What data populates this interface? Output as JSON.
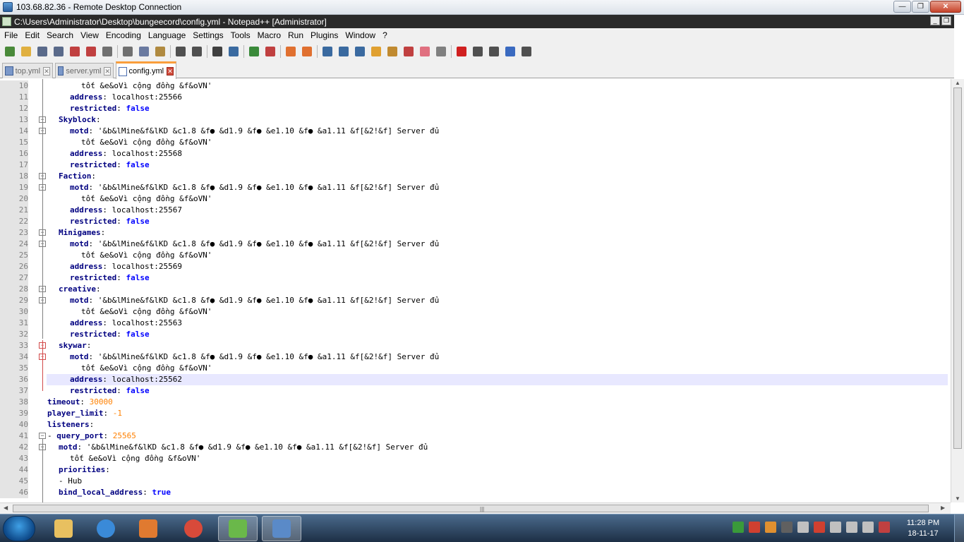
{
  "rdp": {
    "title": "103.68.82.36 - Remote Desktop Connection"
  },
  "window": {
    "title": "C:\\Users\\Administrator\\Desktop\\bungeecord\\config.yml - Notepad++ [Administrator]"
  },
  "menu": [
    "File",
    "Edit",
    "Search",
    "View",
    "Encoding",
    "Language",
    "Settings",
    "Tools",
    "Macro",
    "Run",
    "Plugins",
    "Window",
    "?"
  ],
  "toolbar": {
    "buttons": [
      {
        "icon": "new-file-icon",
        "color": "#4a8a3a"
      },
      {
        "icon": "open-file-icon",
        "color": "#e0b040"
      },
      {
        "icon": "save-icon",
        "color": "#5a6a8a"
      },
      {
        "icon": "save-all-icon",
        "color": "#5a6a8a"
      },
      {
        "icon": "close-icon",
        "color": "#c04040"
      },
      {
        "icon": "close-all-icon",
        "color": "#c04040"
      },
      {
        "icon": "print-icon",
        "color": "#707070"
      },
      {
        "sep": true
      },
      {
        "icon": "cut-icon",
        "color": "#707070"
      },
      {
        "icon": "copy-icon",
        "color": "#6a7aa0"
      },
      {
        "icon": "paste-icon",
        "color": "#b08a40"
      },
      {
        "sep": true
      },
      {
        "icon": "undo-icon",
        "color": "#505050"
      },
      {
        "icon": "redo-icon",
        "color": "#505050"
      },
      {
        "sep": true
      },
      {
        "icon": "find-icon",
        "color": "#404040"
      },
      {
        "icon": "replace-icon",
        "color": "#3a6aa0"
      },
      {
        "sep": true
      },
      {
        "icon": "zoom-in-icon",
        "color": "#3a8a3a"
      },
      {
        "icon": "zoom-out-icon",
        "color": "#c04040"
      },
      {
        "sep": true
      },
      {
        "icon": "sync-vertical-icon",
        "color": "#e07030"
      },
      {
        "icon": "sync-horizontal-icon",
        "color": "#e07030"
      },
      {
        "sep": true
      },
      {
        "icon": "word-wrap-icon",
        "color": "#3a6aa0"
      },
      {
        "icon": "show-all-characters-icon",
        "color": "#3a6aa0"
      },
      {
        "icon": "indent-guide-icon",
        "color": "#3a6aa0"
      },
      {
        "icon": "udl-icon",
        "color": "#e0a030"
      },
      {
        "icon": "doc-map-icon",
        "color": "#c08a30"
      },
      {
        "icon": "function-list-icon",
        "color": "#c04040"
      },
      {
        "icon": "folder-as-workspace-icon",
        "color": "#e07080"
      },
      {
        "icon": "monitoring-icon",
        "color": "#808080"
      },
      {
        "sep": true
      },
      {
        "icon": "record-macro-icon",
        "color": "#d02020"
      },
      {
        "icon": "stop-recording-icon",
        "color": "#505050"
      },
      {
        "icon": "playback-icon",
        "color": "#505050"
      },
      {
        "icon": "run-macro-multiple-icon",
        "color": "#3a6ac0"
      },
      {
        "icon": "save-macro-icon",
        "color": "#505050"
      }
    ]
  },
  "tabs": [
    {
      "label": "top.yml",
      "active": false
    },
    {
      "label": "server.yml",
      "active": false
    },
    {
      "label": "config.yml",
      "active": true
    }
  ],
  "editor": {
    "lines": [
      {
        "n": "10",
        "indent": 3,
        "parts": [
          {
            "t": "tốt &e&oVì cộng đồng &f&oVN'",
            "c": "v"
          }
        ]
      },
      {
        "n": "11",
        "indent": 2,
        "parts": [
          {
            "t": "address",
            "c": "k"
          },
          {
            "t": ": localhost:25566",
            "c": "v"
          }
        ]
      },
      {
        "n": "12",
        "indent": 2,
        "parts": [
          {
            "t": "restricted",
            "c": "k"
          },
          {
            "t": ": ",
            "c": "v"
          },
          {
            "t": "false",
            "c": "b"
          }
        ]
      },
      {
        "n": "13",
        "indent": 1,
        "parts": [
          {
            "t": "Skyblock",
            "c": "k"
          },
          {
            "t": ":",
            "c": "v"
          }
        ]
      },
      {
        "n": "14",
        "indent": 2,
        "parts": [
          {
            "t": "motd",
            "c": "k"
          },
          {
            "t": ": '&b&lMine&f&lKD &c1.8 &f● &d1.9 &f● &e1.10 &f● &a1.11 &f[&2!&f] Server đủ",
            "c": "v"
          }
        ]
      },
      {
        "n": "15",
        "indent": 3,
        "parts": [
          {
            "t": "tốt &e&oVì cộng đồng &f&oVN'",
            "c": "v"
          }
        ]
      },
      {
        "n": "16",
        "indent": 2,
        "parts": [
          {
            "t": "address",
            "c": "k"
          },
          {
            "t": ": localhost:25568",
            "c": "v"
          }
        ]
      },
      {
        "n": "17",
        "indent": 2,
        "parts": [
          {
            "t": "restricted",
            "c": "k"
          },
          {
            "t": ": ",
            "c": "v"
          },
          {
            "t": "false",
            "c": "b"
          }
        ]
      },
      {
        "n": "18",
        "indent": 1,
        "parts": [
          {
            "t": "Faction",
            "c": "k"
          },
          {
            "t": ":",
            "c": "v"
          }
        ]
      },
      {
        "n": "19",
        "indent": 2,
        "parts": [
          {
            "t": "motd",
            "c": "k"
          },
          {
            "t": ": '&b&lMine&f&lKD &c1.8 &f● &d1.9 &f● &e1.10 &f● &a1.11 &f[&2!&f] Server đủ",
            "c": "v"
          }
        ]
      },
      {
        "n": "20",
        "indent": 3,
        "parts": [
          {
            "t": "tốt &e&oVì cộng đồng &f&oVN'",
            "c": "v"
          }
        ]
      },
      {
        "n": "21",
        "indent": 2,
        "parts": [
          {
            "t": "address",
            "c": "k"
          },
          {
            "t": ": localhost:25567",
            "c": "v"
          }
        ]
      },
      {
        "n": "22",
        "indent": 2,
        "parts": [
          {
            "t": "restricted",
            "c": "k"
          },
          {
            "t": ": ",
            "c": "v"
          },
          {
            "t": "false",
            "c": "b"
          }
        ]
      },
      {
        "n": "23",
        "indent": 1,
        "parts": [
          {
            "t": "Minigames",
            "c": "k"
          },
          {
            "t": ":",
            "c": "v"
          }
        ]
      },
      {
        "n": "24",
        "indent": 2,
        "parts": [
          {
            "t": "motd",
            "c": "k"
          },
          {
            "t": ": '&b&lMine&f&lKD &c1.8 &f● &d1.9 &f● &e1.10 &f● &a1.11 &f[&2!&f] Server đủ",
            "c": "v"
          }
        ]
      },
      {
        "n": "25",
        "indent": 3,
        "parts": [
          {
            "t": "tốt &e&oVì cộng đồng &f&oVN'",
            "c": "v"
          }
        ]
      },
      {
        "n": "26",
        "indent": 2,
        "parts": [
          {
            "t": "address",
            "c": "k"
          },
          {
            "t": ": localhost:25569",
            "c": "v"
          }
        ]
      },
      {
        "n": "27",
        "indent": 2,
        "parts": [
          {
            "t": "restricted",
            "c": "k"
          },
          {
            "t": ": ",
            "c": "v"
          },
          {
            "t": "false",
            "c": "b"
          }
        ]
      },
      {
        "n": "28",
        "indent": 1,
        "parts": [
          {
            "t": "creative",
            "c": "k"
          },
          {
            "t": ":",
            "c": "v"
          }
        ]
      },
      {
        "n": "29",
        "indent": 2,
        "parts": [
          {
            "t": "motd",
            "c": "k"
          },
          {
            "t": ": '&b&lMine&f&lKD &c1.8 &f● &d1.9 &f● &e1.10 &f● &a1.11 &f[&2!&f] Server đủ",
            "c": "v"
          }
        ]
      },
      {
        "n": "30",
        "indent": 3,
        "parts": [
          {
            "t": "tốt &e&oVì cộng đồng &f&oVN'",
            "c": "v"
          }
        ]
      },
      {
        "n": "31",
        "indent": 2,
        "parts": [
          {
            "t": "address",
            "c": "k"
          },
          {
            "t": ": localhost:25563",
            "c": "v"
          }
        ]
      },
      {
        "n": "32",
        "indent": 2,
        "parts": [
          {
            "t": "restricted",
            "c": "k"
          },
          {
            "t": ": ",
            "c": "v"
          },
          {
            "t": "false",
            "c": "b"
          }
        ]
      },
      {
        "n": "33",
        "indent": 1,
        "parts": [
          {
            "t": "skywar",
            "c": "k"
          },
          {
            "t": ":",
            "c": "v"
          }
        ]
      },
      {
        "n": "34",
        "indent": 2,
        "parts": [
          {
            "t": "motd",
            "c": "k"
          },
          {
            "t": ": '&b&lMine&f&lKD &c1.8 &f● &d1.9 &f● &e1.10 &f● &a1.11 &f[&2!&f] Server đủ",
            "c": "v"
          }
        ]
      },
      {
        "n": "35",
        "indent": 3,
        "parts": [
          {
            "t": "tốt &e&oVì cộng đồng &f&oVN'",
            "c": "v"
          }
        ]
      },
      {
        "n": "36",
        "indent": 2,
        "current": true,
        "parts": [
          {
            "t": "address",
            "c": "k"
          },
          {
            "t": ": localhost:25562",
            "c": "v"
          }
        ]
      },
      {
        "n": "37",
        "indent": 2,
        "parts": [
          {
            "t": "restricted",
            "c": "k"
          },
          {
            "t": ": ",
            "c": "v"
          },
          {
            "t": "false",
            "c": "b"
          }
        ]
      },
      {
        "n": "38",
        "indent": 0,
        "parts": [
          {
            "t": "timeout",
            "c": "k"
          },
          {
            "t": ": ",
            "c": "v"
          },
          {
            "t": "30000",
            "c": "n"
          }
        ]
      },
      {
        "n": "39",
        "indent": 0,
        "parts": [
          {
            "t": "player_limit",
            "c": "k"
          },
          {
            "t": ": ",
            "c": "v"
          },
          {
            "t": "-1",
            "c": "n"
          }
        ]
      },
      {
        "n": "40",
        "indent": 0,
        "parts": [
          {
            "t": "listeners",
            "c": "k"
          },
          {
            "t": ":",
            "c": "v"
          }
        ]
      },
      {
        "n": "41",
        "indent": 0,
        "parts": [
          {
            "t": "- ",
            "c": "v"
          },
          {
            "t": "query_port",
            "c": "k"
          },
          {
            "t": ": ",
            "c": "v"
          },
          {
            "t": "25565",
            "c": "n"
          }
        ]
      },
      {
        "n": "42",
        "indent": 1,
        "parts": [
          {
            "t": "motd",
            "c": "k"
          },
          {
            "t": ": '&b&lMine&f&lKD &c1.8 &f● &d1.9 &f● &e1.10 &f● &a1.11 &f[&2!&f] Server đủ",
            "c": "v"
          }
        ]
      },
      {
        "n": "43",
        "indent": 2,
        "parts": [
          {
            "t": "tốt &e&oVì cộng đồng &f&oVN'",
            "c": "v"
          }
        ]
      },
      {
        "n": "44",
        "indent": 1,
        "parts": [
          {
            "t": "priorities",
            "c": "k"
          },
          {
            "t": ":",
            "c": "v"
          }
        ]
      },
      {
        "n": "45",
        "indent": 1,
        "parts": [
          {
            "t": "- Hub",
            "c": "v"
          }
        ]
      },
      {
        "n": "46",
        "indent": 1,
        "parts": [
          {
            "t": "bind_local_address",
            "c": "k"
          },
          {
            "t": ": ",
            "c": "v"
          },
          {
            "t": "true",
            "c": "b"
          }
        ]
      }
    ]
  },
  "taskbar": {
    "apps": [
      {
        "name": "explorer-taskbar-button",
        "color": "#e8c060",
        "active": false
      },
      {
        "name": "internet-explorer-taskbar-button",
        "color": "#3a8ad8",
        "active": false
      },
      {
        "name": "media-player-taskbar-button",
        "color": "#e07a30",
        "active": false
      },
      {
        "name": "chrome-taskbar-button",
        "color": "#d84a3a",
        "active": false
      },
      {
        "name": "notepadpp-taskbar-button",
        "color": "#6ab84a",
        "active": true
      },
      {
        "name": "remote-desktop-taskbar-button",
        "color": "#5a8ac8",
        "active": true
      }
    ],
    "tray": [
      "#3a9a3a",
      "#d04030",
      "#e09030",
      "#606060",
      "#c0c0c0",
      "#d04030",
      "#c0c0c0",
      "#c0c0c0",
      "#c0c0c0",
      "#c04040"
    ],
    "time": "11:28 PM",
    "date": "18-11-17"
  }
}
